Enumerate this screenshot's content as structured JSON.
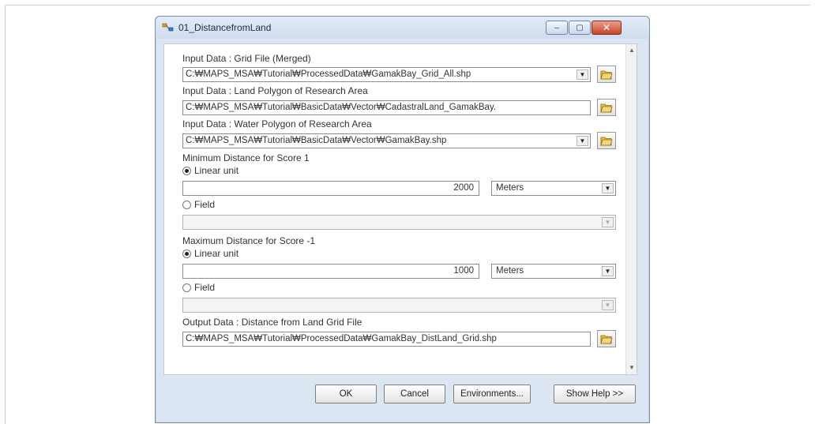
{
  "window": {
    "title": "01_DistancefromLand",
    "controls": {
      "minimize": "‒",
      "maximize": "▢",
      "close": "✕"
    }
  },
  "form": {
    "input_grid": {
      "label": "Input Data : Grid File (Merged)",
      "value": "C:₩MAPS_MSA₩Tutorial₩ProcessedData₩GamakBay_Grid_All.shp"
    },
    "land_polygon": {
      "label": "Input Data : Land Polygon of Research Area",
      "value": "C:₩MAPS_MSA₩Tutorial₩BasicData₩Vector₩CadastralLand_GamakBay."
    },
    "water_polygon": {
      "label": "Input Data : Water Polygon of Research Area",
      "value": "C:₩MAPS_MSA₩Tutorial₩BasicData₩Vector₩GamakBay.shp"
    },
    "min_distance": {
      "label": "Minimum Distance for Score 1",
      "linear_unit_label": "Linear unit",
      "value": "2000",
      "unit": "Meters",
      "field_label": "Field",
      "field_value": ""
    },
    "max_distance": {
      "label": "Maximum Distance for Score -1",
      "linear_unit_label": "Linear unit",
      "value": "1000",
      "unit": "Meters",
      "field_label": "Field",
      "field_value": ""
    },
    "output": {
      "label": "Output Data : Distance from Land Grid File",
      "value": "C:₩MAPS_MSA₩Tutorial₩ProcessedData₩GamakBay_DistLand_Grid.shp"
    }
  },
  "buttons": {
    "ok": "OK",
    "cancel": "Cancel",
    "environments": "Environments...",
    "show_help": "Show Help >>"
  },
  "icons": {
    "title": "model-tool-icon",
    "browse": "open-folder-icon",
    "dropdown": "chevron-down-icon"
  }
}
